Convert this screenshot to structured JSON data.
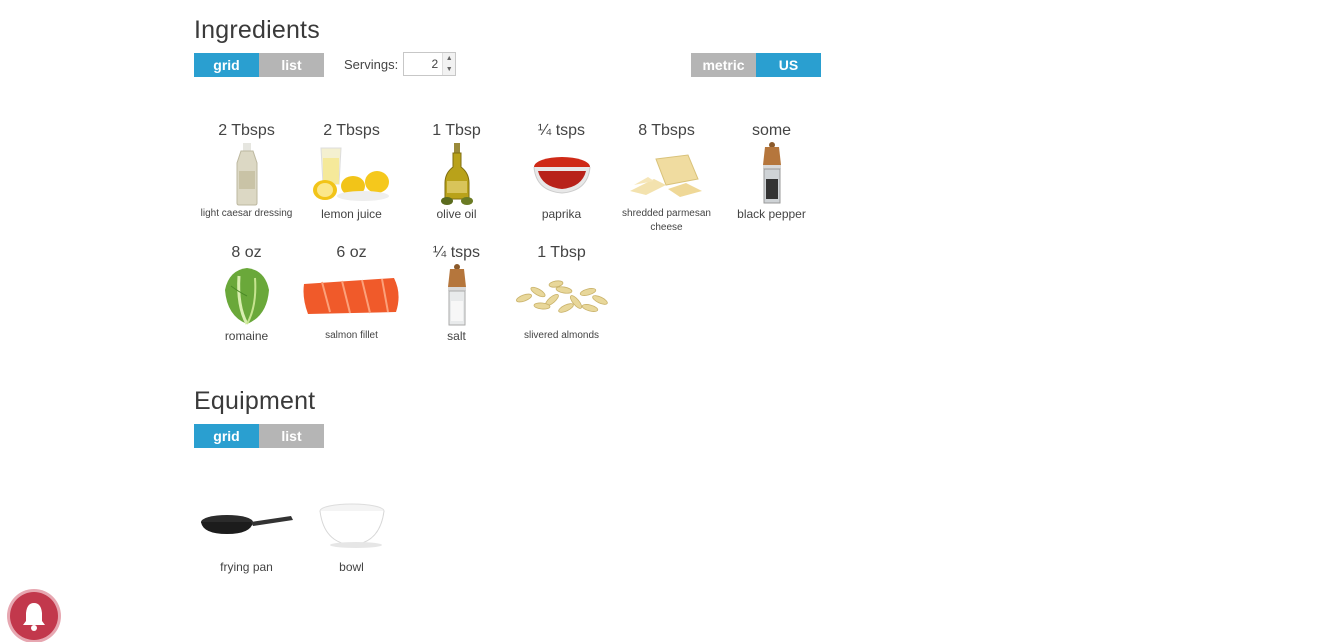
{
  "ingredients": {
    "title": "Ingredients",
    "view_toggle": {
      "grid": "grid",
      "list": "list",
      "selected": "grid"
    },
    "servings": {
      "label": "Servings:",
      "value": "2"
    },
    "unit_toggle": {
      "metric": "metric",
      "us": "US",
      "selected": "US"
    },
    "items": [
      {
        "amount": "2 Tbsps",
        "name": "light caesar dressing",
        "icon": "dressing-bottle-icon"
      },
      {
        "amount": "2 Tbsps",
        "name": "lemon juice",
        "icon": "lemon-juice-icon"
      },
      {
        "amount": "1 Tbsp",
        "name": "olive oil",
        "icon": "olive-oil-icon"
      },
      {
        "amount": "¼ tsps",
        "name": "paprika",
        "icon": "paprika-bowl-icon"
      },
      {
        "amount": "8 Tbsps",
        "name": "shredded parmesan cheese",
        "icon": "parmesan-icon"
      },
      {
        "amount": "some",
        "name": "black pepper",
        "icon": "pepper-grinder-icon"
      },
      {
        "amount": "8 oz",
        "name": "romaine",
        "icon": "romaine-icon"
      },
      {
        "amount": "6 oz",
        "name": "salmon fillet",
        "icon": "salmon-icon"
      },
      {
        "amount": "¼ tsps",
        "name": "salt",
        "icon": "salt-grinder-icon"
      },
      {
        "amount": "1 Tbsp",
        "name": "slivered almonds",
        "icon": "almonds-icon"
      }
    ]
  },
  "equipment": {
    "title": "Equipment",
    "view_toggle": {
      "grid": "grid",
      "list": "list",
      "selected": "grid"
    },
    "items": [
      {
        "name": "frying pan",
        "icon": "frying-pan-icon"
      },
      {
        "name": "bowl",
        "icon": "bowl-icon"
      }
    ]
  },
  "notification": {
    "icon": "bell-icon"
  },
  "colors": {
    "accent": "#2a9fd0",
    "inactive": "#b5b5b5",
    "bell": "#c2384c"
  }
}
